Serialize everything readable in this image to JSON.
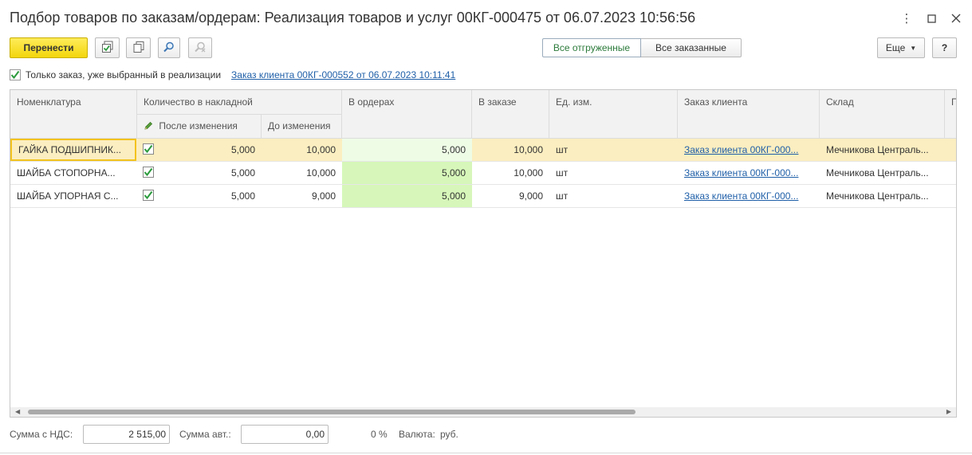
{
  "window": {
    "title": "Подбор товаров по заказам/ордерам: Реализация товаров и услуг 00КГ-000475 от 06.07.2023 10:56:56",
    "more_icon": "⋮",
    "maximize_icon": "☐",
    "close_icon": "✕"
  },
  "toolbar": {
    "transfer_label": "Перенести",
    "check_all_icon": "check-all",
    "copy_icon": "copy",
    "find_icon": "find",
    "find_cancel_icon": "find-cancel",
    "shipped_label": "Все отгруженные",
    "ordered_label": "Все заказанные",
    "more_label": "Еще",
    "help_label": "?"
  },
  "filter": {
    "checked": true,
    "label": "Только заказ, уже выбранный в реализации",
    "link": "Заказ клиента 00КГ-000552 от 06.07.2023 10:11:41"
  },
  "columns": {
    "name": "Номенклатура",
    "qty_group": "Количество в накладной",
    "after": "После изменения",
    "before": "До изменения",
    "in_orders": "В ордерах",
    "in_order": "В заказе",
    "unit": "Ед. изм.",
    "client_order": "Заказ клиента",
    "warehouse": "Склад",
    "next": "П"
  },
  "rows": [
    {
      "name": "ГАЙКА ПОДШИПНИК...",
      "checked": true,
      "after": "5,000",
      "before": "10,000",
      "in_orders": "5,000",
      "in_order": "10,000",
      "unit": "шт",
      "client_order": "Заказ клиента 00КГ-000...",
      "warehouse": "Мечникова Централь..."
    },
    {
      "name": "ШАЙБА СТОПОРНА...",
      "checked": true,
      "after": "5,000",
      "before": "10,000",
      "in_orders": "5,000",
      "in_order": "10,000",
      "unit": "шт",
      "client_order": "Заказ клиента 00КГ-000...",
      "warehouse": "Мечникова Централь..."
    },
    {
      "name": "ШАЙБА УПОРНАЯ С...",
      "checked": true,
      "after": "5,000",
      "before": "9,000",
      "in_orders": "5,000",
      "in_order": "9,000",
      "unit": "шт",
      "client_order": "Заказ клиента 00КГ-000...",
      "warehouse": "Мечникова Централь..."
    }
  ],
  "footer": {
    "sum_vat_label": "Сумма с НДС:",
    "sum_vat_value": "2 515,00",
    "sum_auto_label": "Сумма авт.:",
    "sum_auto_value": "0,00",
    "percent": "0 %",
    "currency_label": "Валюта:",
    "currency_value": "руб."
  }
}
